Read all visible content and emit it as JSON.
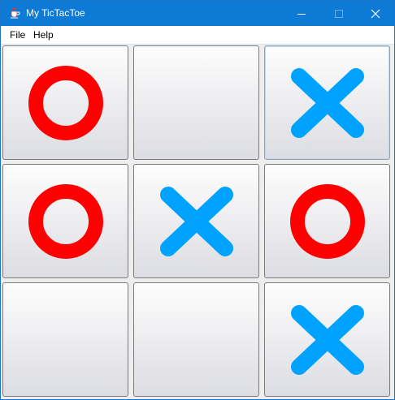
{
  "window": {
    "title": "My TicTacToe",
    "app_icon": "java-coffee-cup-icon",
    "controls": {
      "minimize_icon": "minimize-icon",
      "maximize_icon": "maximize-icon",
      "close_icon": "close-icon"
    }
  },
  "menu": {
    "items": [
      {
        "label": "File"
      },
      {
        "label": "Help"
      }
    ]
  },
  "board": {
    "rows": 3,
    "cols": 3,
    "cells": [
      "O",
      "",
      "X",
      "O",
      "X",
      "O",
      "",
      "",
      "X"
    ],
    "colors": {
      "O": "#ff0000",
      "X": "#00a2ff"
    }
  },
  "colors": {
    "titlebar": "#0d7bd6",
    "window_background": "#eeeeee"
  }
}
